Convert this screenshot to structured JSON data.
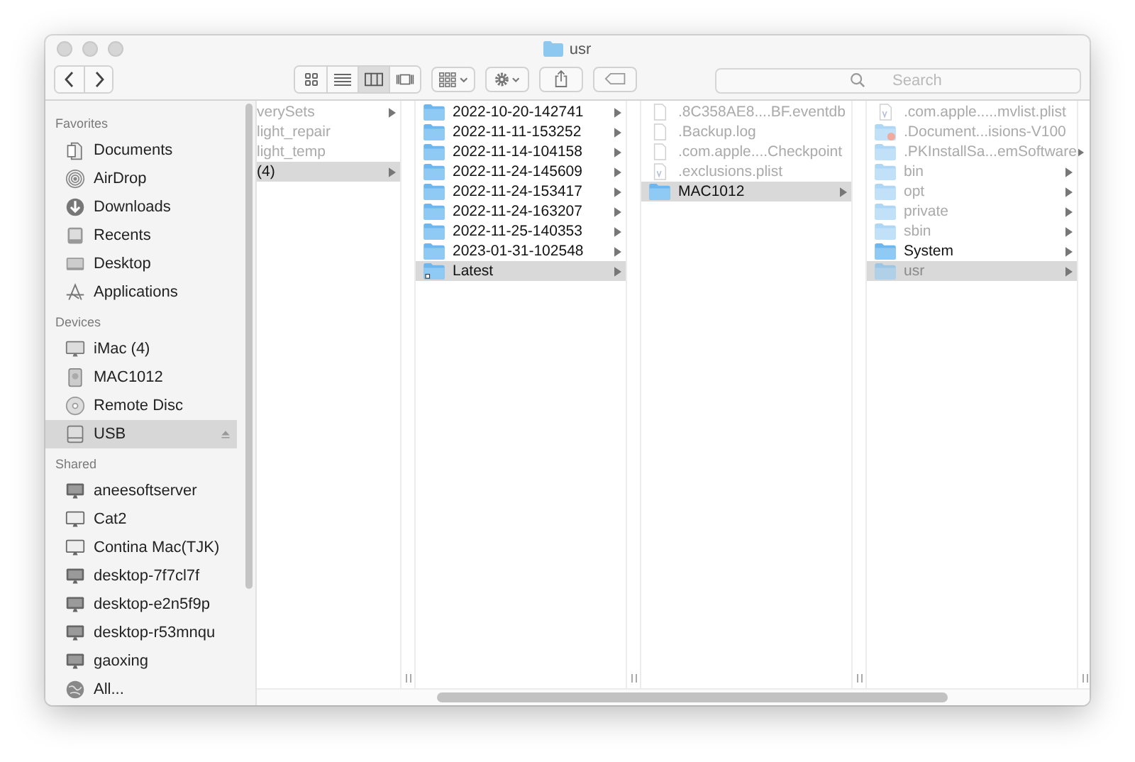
{
  "window": {
    "title": "usr"
  },
  "toolbar": {
    "views": [
      {
        "kind": "icons",
        "selected": false
      },
      {
        "kind": "list",
        "selected": false
      },
      {
        "kind": "columns",
        "selected": true
      },
      {
        "kind": "gallery",
        "selected": false
      }
    ],
    "search": {
      "placeholder": "Search"
    }
  },
  "sidebar": {
    "sections": [
      {
        "title": "Favorites",
        "items": [
          {
            "label": "Documents",
            "kind": "documents",
            "selected": false
          },
          {
            "label": "AirDrop",
            "kind": "airdrop",
            "selected": false
          },
          {
            "label": "Downloads",
            "kind": "downloads",
            "selected": false
          },
          {
            "label": "Recents",
            "kind": "recents",
            "selected": false
          },
          {
            "label": "Desktop",
            "kind": "desktop",
            "selected": false
          },
          {
            "label": "Applications",
            "kind": "applications",
            "selected": false
          }
        ]
      },
      {
        "title": "Devices",
        "items": [
          {
            "label": "iMac (4)",
            "kind": "imac",
            "selected": false
          },
          {
            "label": "MAC1012",
            "kind": "disk",
            "selected": false
          },
          {
            "label": "Remote Disc",
            "kind": "disc",
            "selected": false
          },
          {
            "label": "USB",
            "kind": "drive",
            "selected": true,
            "eject": true
          }
        ]
      },
      {
        "title": "Shared",
        "items": [
          {
            "label": "aneesoftserver",
            "kind": "server",
            "selected": false
          },
          {
            "label": "Cat2",
            "kind": "computer",
            "selected": false
          },
          {
            "label": "Contina Mac(TJK)",
            "kind": "computer",
            "selected": false
          },
          {
            "label": "desktop-7f7cl7f",
            "kind": "server",
            "selected": false
          },
          {
            "label": "desktop-e2n5f9p",
            "kind": "server",
            "selected": false
          },
          {
            "label": "desktop-r53mnqu",
            "kind": "server",
            "selected": false
          },
          {
            "label": "gaoxing",
            "kind": "server",
            "selected": false
          },
          {
            "label": "All...",
            "kind": "network",
            "selected": false
          }
        ]
      }
    ]
  },
  "columns": [
    {
      "items": [
        {
          "name": "verySets",
          "kind": "none",
          "dimmed": true,
          "has_children": true,
          "selected": false
        },
        {
          "name": "light_repair",
          "kind": "none",
          "dimmed": true,
          "has_children": false,
          "selected": false
        },
        {
          "name": "light_temp",
          "kind": "none",
          "dimmed": true,
          "has_children": false,
          "selected": false
        },
        {
          "name": "(4)",
          "kind": "none",
          "dimmed": false,
          "has_children": true,
          "selected": true
        }
      ]
    },
    {
      "items": [
        {
          "name": "2022-10-20-142741",
          "kind": "folder",
          "dimmed": false,
          "has_children": true,
          "selected": false
        },
        {
          "name": "2022-11-11-153252",
          "kind": "folder",
          "dimmed": false,
          "has_children": true,
          "selected": false
        },
        {
          "name": "2022-11-14-104158",
          "kind": "folder",
          "dimmed": false,
          "has_children": true,
          "selected": false
        },
        {
          "name": "2022-11-24-145609",
          "kind": "folder",
          "dimmed": false,
          "has_children": true,
          "selected": false
        },
        {
          "name": "2022-11-24-153417",
          "kind": "folder",
          "dimmed": false,
          "has_children": true,
          "selected": false
        },
        {
          "name": "2022-11-24-163207",
          "kind": "folder",
          "dimmed": false,
          "has_children": true,
          "selected": false
        },
        {
          "name": "2022-11-25-140353",
          "kind": "folder",
          "dimmed": false,
          "has_children": true,
          "selected": false
        },
        {
          "name": "2023-01-31-102548",
          "kind": "folder",
          "dimmed": false,
          "has_children": true,
          "selected": false
        },
        {
          "name": "Latest",
          "kind": "alias-folder",
          "dimmed": false,
          "has_children": true,
          "selected": true
        }
      ]
    },
    {
      "items": [
        {
          "name": ".8C358AE8....BF.eventdb",
          "kind": "file",
          "dimmed": true,
          "has_children": false,
          "selected": false
        },
        {
          "name": ".Backup.log",
          "kind": "file",
          "dimmed": true,
          "has_children": false,
          "selected": false
        },
        {
          "name": ".com.apple....Checkpoint",
          "kind": "file",
          "dimmed": true,
          "has_children": false,
          "selected": false
        },
        {
          "name": ".exclusions.plist",
          "kind": "plist",
          "dimmed": true,
          "has_children": false,
          "selected": false
        },
        {
          "name": "MAC1012",
          "kind": "folder",
          "dimmed": false,
          "has_children": true,
          "selected": true
        }
      ]
    },
    {
      "items": [
        {
          "name": ".com.apple.....mvlist.plist",
          "kind": "plist",
          "dimmed": true,
          "has_children": false,
          "selected": false
        },
        {
          "name": ".Document...isions-V100",
          "kind": "locked-folder",
          "dimmed": true,
          "has_children": false,
          "selected": false
        },
        {
          "name": ".PKInstallSa...emSoftware",
          "kind": "folder",
          "dimmed": true,
          "has_children": true,
          "selected": false
        },
        {
          "name": "bin",
          "kind": "folder",
          "dimmed": true,
          "has_children": true,
          "selected": false
        },
        {
          "name": "opt",
          "kind": "folder",
          "dimmed": true,
          "has_children": true,
          "selected": false
        },
        {
          "name": "private",
          "kind": "folder",
          "dimmed": true,
          "has_children": true,
          "selected": false
        },
        {
          "name": "sbin",
          "kind": "folder",
          "dimmed": true,
          "has_children": true,
          "selected": false
        },
        {
          "name": "System",
          "kind": "folder",
          "dimmed": false,
          "has_children": true,
          "selected": false
        },
        {
          "name": "usr",
          "kind": "folder",
          "dimmed": true,
          "has_children": true,
          "selected": true
        }
      ]
    }
  ]
}
